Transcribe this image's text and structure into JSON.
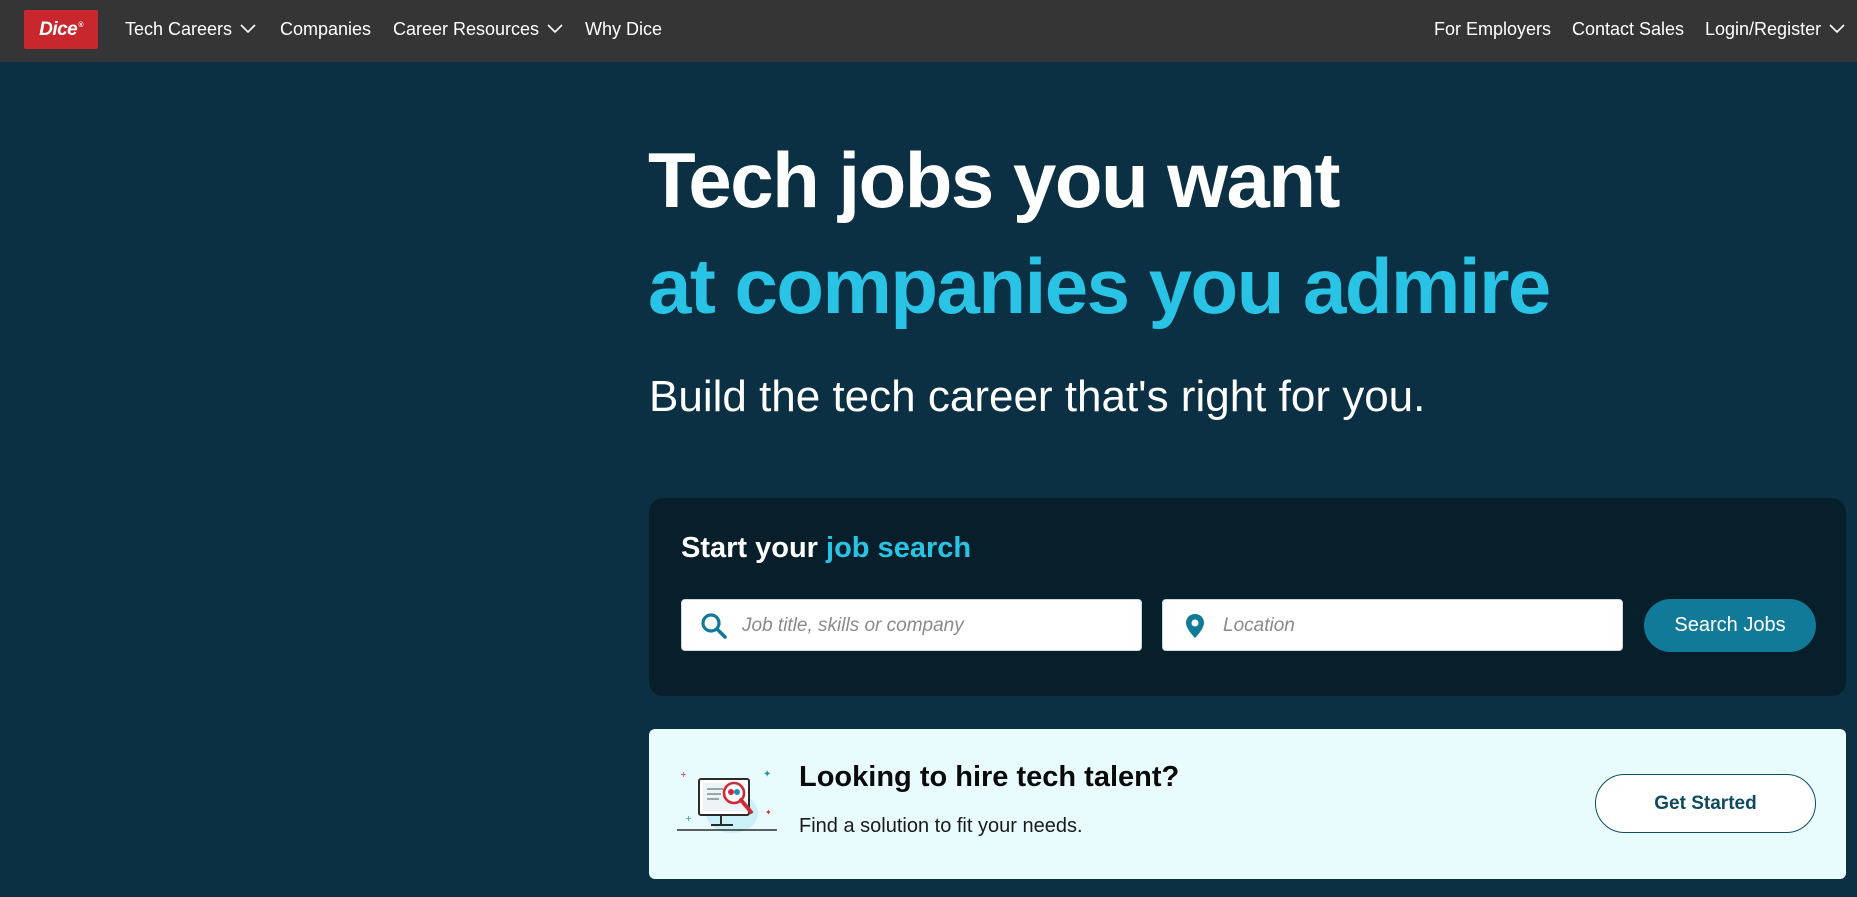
{
  "nav": {
    "logo_text": "Dice",
    "logo_mark": "®",
    "tech_careers": "Tech Careers",
    "companies": "Companies",
    "career_resources": "Career Resources",
    "why_dice": "Why Dice",
    "for_employers": "For Employers",
    "contact_sales": "Contact Sales",
    "login_register": "Login/Register"
  },
  "hero": {
    "headline_line1": "Tech jobs you want",
    "headline_line2": "at companies you admire",
    "subtitle": "Build the tech career that's right for you."
  },
  "search": {
    "heading_prefix": "Start your ",
    "heading_highlight": "job search",
    "query_placeholder": "Job title, skills or company",
    "location_placeholder": "Location",
    "button_label": "Search Jobs"
  },
  "hire": {
    "title": "Looking to hire tech talent?",
    "description": "Find a solution to fit your needs.",
    "button_label": "Get Started"
  },
  "colors": {
    "nav_bg": "#353535",
    "page_bg": "#0b3043",
    "accent_cyan": "#29c4e5",
    "brand_red": "#c8282d",
    "button_teal": "#117a99",
    "hire_card_bg": "#e9fcfd"
  },
  "icons": {
    "search": "magnifier-icon",
    "location": "map-pin-icon",
    "dropdown": "chevron-down-icon",
    "hire": "monitor-magnifier-illustration"
  }
}
